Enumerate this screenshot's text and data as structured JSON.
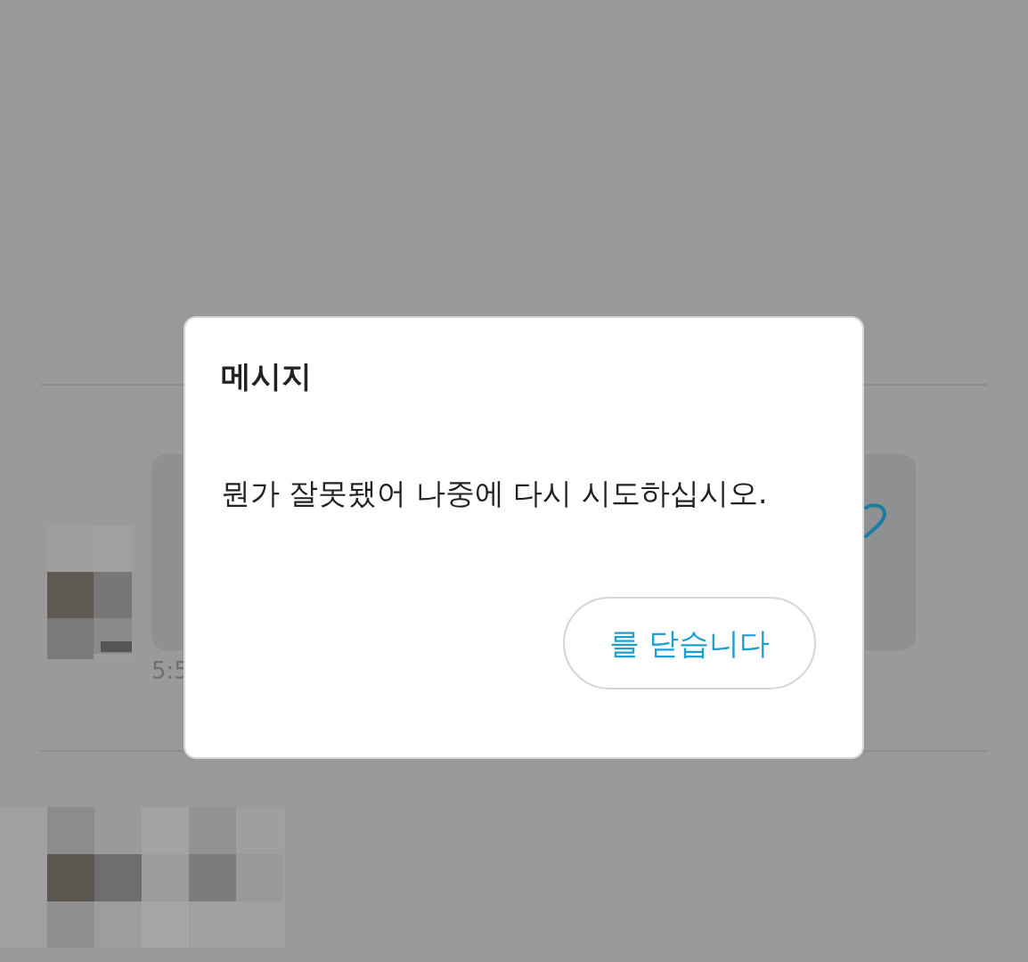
{
  "background": {
    "timestamp": "5:5"
  },
  "dialog": {
    "title": "메시지",
    "message": "뭔가 잘못됐어 나중에 다시 시도하십시오.",
    "button": "를 닫습니다"
  }
}
